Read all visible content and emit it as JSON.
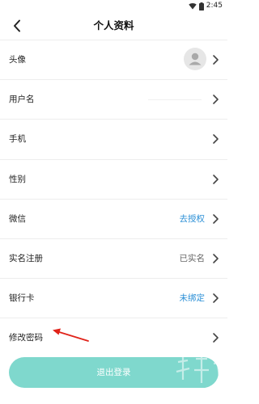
{
  "status_bar": {
    "time": "2:45"
  },
  "header": {
    "title": "个人资料"
  },
  "rows": [
    {
      "label": "头像",
      "value": ""
    },
    {
      "label": "用户名",
      "value": ""
    },
    {
      "label": "手机",
      "value": ""
    },
    {
      "label": "性别",
      "value": ""
    },
    {
      "label": "微信",
      "value": "去授权"
    },
    {
      "label": "实名注册",
      "value": "已实名"
    },
    {
      "label": "银行卡",
      "value": "未绑定"
    },
    {
      "label": "修改密码",
      "value": ""
    }
  ],
  "logout_button": {
    "label": "退出登录"
  },
  "colors": {
    "accent_button": "#7fd8cd",
    "link_blue": "#2b8fd6",
    "annotation_red": "#e0231a"
  },
  "icons": [
    "back-arrow-icon",
    "wifi-icon",
    "battery-icon",
    "chevron-right-icon",
    "avatar-placeholder-icon",
    "annotation-arrow-icon"
  ]
}
